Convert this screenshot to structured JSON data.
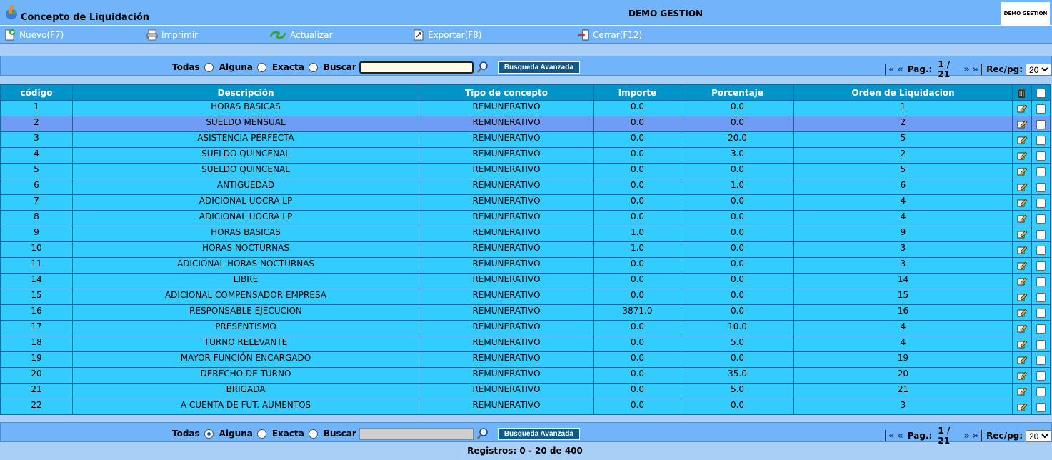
{
  "app": {
    "title": "Concepto de Liquidación",
    "company": "DEMO GESTION",
    "brand_logo_text": "DEMO GESTION"
  },
  "toolbar": {
    "new_label": "Nuevo(F7)",
    "print_label": "Imprimir",
    "refresh_label": "Actualizar",
    "export_label": "Exportar(F8)",
    "close_label": "Cerrar(F12)"
  },
  "filter": {
    "todas": "Todas",
    "alguna": "Alguna",
    "exacta": "Exacta",
    "buscar": "Buscar",
    "search_value": "",
    "advanced_label": "Busqueda Avanzada",
    "top_selected": "none",
    "bottom_selected": "Alguna"
  },
  "pager": {
    "first": "«",
    "prev": "«",
    "page_label": "Pag.:",
    "page_value": "1 / 21",
    "next": "»",
    "last": "»",
    "recpg_label": "Rec/pg:",
    "recpg_value": "20"
  },
  "table": {
    "columns": [
      "código",
      "Descripción",
      "Tipo de concepto",
      "Importe",
      "Porcentaje",
      "Orden de Liquidacion"
    ],
    "selected_row_index": 1,
    "rows": [
      [
        "1",
        "HORAS BASICAS",
        "REMUNERATIVO",
        "0.0",
        "0.0",
        "1"
      ],
      [
        "2",
        "SUELDO MENSUAL",
        "REMUNERATIVO",
        "0.0",
        "0.0",
        "2"
      ],
      [
        "3",
        "ASISTENCIA PERFECTA",
        "REMUNERATIVO",
        "0.0",
        "20.0",
        "5"
      ],
      [
        "4",
        "SUELDO QUINCENAL",
        "REMUNERATIVO",
        "0.0",
        "3.0",
        "2"
      ],
      [
        "5",
        "SUELDO QUINCENAL",
        "REMUNERATIVO",
        "0.0",
        "0.0",
        "5"
      ],
      [
        "6",
        "ANTIGUEDAD",
        "REMUNERATIVO",
        "0.0",
        "1.0",
        "6"
      ],
      [
        "7",
        "ADICIONAL UOCRA LP",
        "REMUNERATIVO",
        "0.0",
        "0.0",
        "4"
      ],
      [
        "8",
        "ADICIONAL UOCRA LP",
        "REMUNERATIVO",
        "0.0",
        "0.0",
        "4"
      ],
      [
        "9",
        "HORAS BASICAS",
        "REMUNERATIVO",
        "1.0",
        "0.0",
        "9"
      ],
      [
        "10",
        "HORAS NOCTURNAS",
        "REMUNERATIVO",
        "1.0",
        "0.0",
        "3"
      ],
      [
        "11",
        "ADICIONAL HORAS NOCTURNAS",
        "REMUNERATIVO",
        "0.0",
        "0.0",
        "3"
      ],
      [
        "14",
        "LIBRE",
        "REMUNERATIVO",
        "0.0",
        "0.0",
        "14"
      ],
      [
        "15",
        "ADICIONAL COMPENSADOR EMPRESA",
        "REMUNERATIVO",
        "0.0",
        "0.0",
        "15"
      ],
      [
        "16",
        "RESPONSABLE EJECUCION",
        "REMUNERATIVO",
        "3871.0",
        "0.0",
        "16"
      ],
      [
        "17",
        "PRESENTISMO",
        "REMUNERATIVO",
        "0.0",
        "10.0",
        "4"
      ],
      [
        "18",
        "TURNO RELEVANTE",
        "REMUNERATIVO",
        "0.0",
        "5.0",
        "4"
      ],
      [
        "19",
        "MAYOR FUNCIÓN ENCARGADO",
        "REMUNERATIVO",
        "0.0",
        "0.0",
        "19"
      ],
      [
        "20",
        "DERECHO DE TURNO",
        "REMUNERATIVO",
        "0.0",
        "35.0",
        "20"
      ],
      [
        "21",
        "BRIGADA",
        "REMUNERATIVO",
        "0.0",
        "5.0",
        "21"
      ],
      [
        "22",
        "A CUENTA DE FUT. AUMENTOS",
        "REMUNERATIVO",
        "0.0",
        "0.0",
        "3"
      ]
    ]
  },
  "footer": {
    "records": "Registros: 0 - 20 de 400"
  },
  "colors": {
    "header_bar": "#71b4fa",
    "grid_header": "#0094c8",
    "row": "#33ccff",
    "row_selected": "#6f9df5",
    "page_bg": "#a9cff6"
  }
}
